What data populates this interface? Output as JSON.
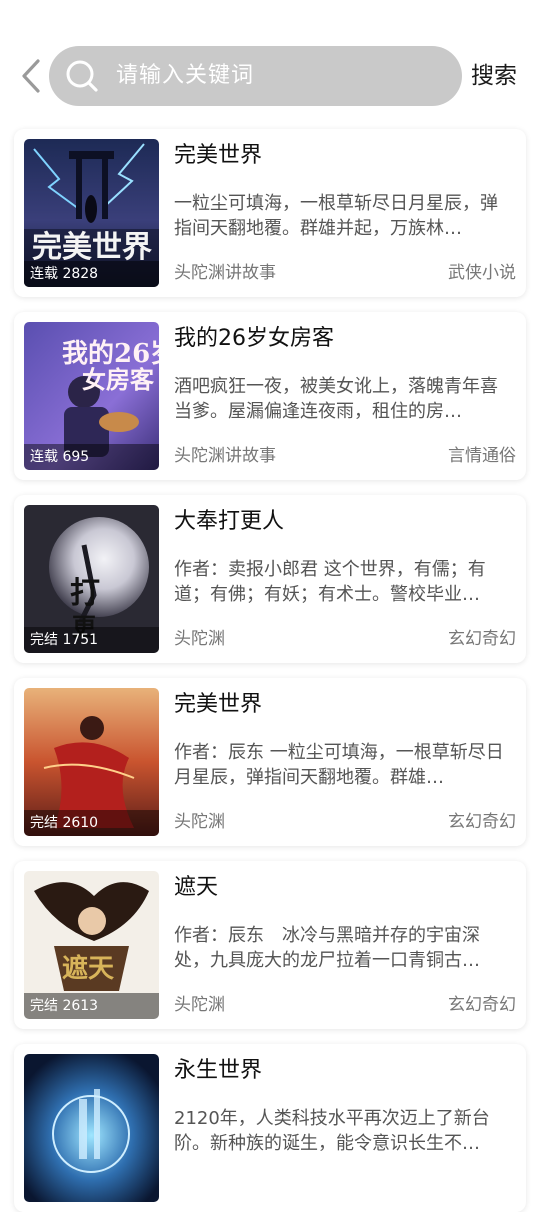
{
  "header": {
    "search_placeholder": "请输入关键词",
    "search_button": "搜索"
  },
  "books": [
    {
      "title": "完美世界",
      "description": "一粒尘可填海，一根草斩尽日月星辰，弹指间天翻地覆。群雄并起，万族林…",
      "author": "头陀渊讲故事",
      "category": "武侠小说",
      "status": "连载 2828"
    },
    {
      "title": "我的26岁女房客",
      "description": "酒吧疯狂一夜，被美女讹上，落魄青年喜当爹。屋漏偏逢连夜雨，租住的房…",
      "author": "头陀渊讲故事",
      "category": "言情通俗",
      "status": "连载 695"
    },
    {
      "title": "大奉打更人",
      "description": "作者：卖报小郎君 这个世界，有儒；有道；有佛；有妖；有术士。警校毕业…",
      "author": "头陀渊",
      "category": "玄幻奇幻",
      "status": "完结 1751"
    },
    {
      "title": "完美世界",
      "description": "作者：辰东 一粒尘可填海，一根草斩尽日月星辰，弹指间天翻地覆。群雄…",
      "author": "头陀渊",
      "category": "玄幻奇幻",
      "status": "完结 2610"
    },
    {
      "title": "遮天",
      "description": "作者：辰东　冰冷与黑暗并存的宇宙深处，九具庞大的龙尸拉着一口青铜古…",
      "author": "头陀渊",
      "category": "玄幻奇幻",
      "status": "完结 2613"
    },
    {
      "title": "永生世界",
      "description": "2120年，人类科技水平再次迈上了新台阶。新种族的诞生，能令意识长生不…",
      "author": "",
      "category": "",
      "status": ""
    }
  ]
}
